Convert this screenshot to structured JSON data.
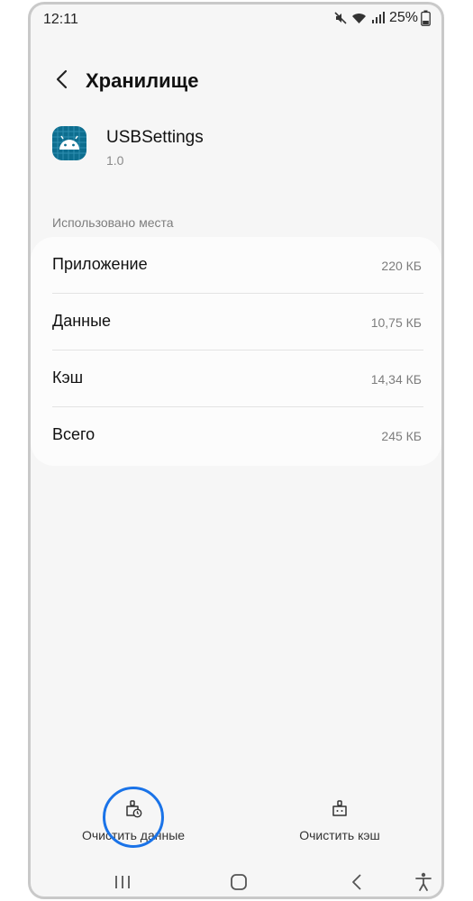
{
  "status_bar": {
    "time": "12:11",
    "battery": "25%",
    "icons": [
      "mute-icon",
      "wifi-icon",
      "signal-icon",
      "battery-icon"
    ]
  },
  "header": {
    "back_icon": "back-arrow-icon",
    "title": "Хранилище"
  },
  "app": {
    "icon": "android-app-icon",
    "name": "USBSettings",
    "version": "1.0"
  },
  "storage": {
    "section_title": "Использовано места",
    "rows": [
      {
        "label": "Приложение",
        "value": "220 КБ"
      },
      {
        "label": "Данные",
        "value": "10,75 КБ"
      },
      {
        "label": "Кэш",
        "value": "14,34 КБ"
      },
      {
        "label": "Всего",
        "value": "245 КБ"
      }
    ]
  },
  "actions": {
    "clear_data": {
      "label": "Очистить данные",
      "icon": "clear-data-icon"
    },
    "clear_cache": {
      "label": "Очистить кэш",
      "icon": "clear-cache-icon"
    }
  },
  "highlight_color": "#1a73e8",
  "nav_bar": {
    "icons": [
      "recents-icon",
      "home-icon",
      "back-icon",
      "accessibility-icon"
    ]
  }
}
